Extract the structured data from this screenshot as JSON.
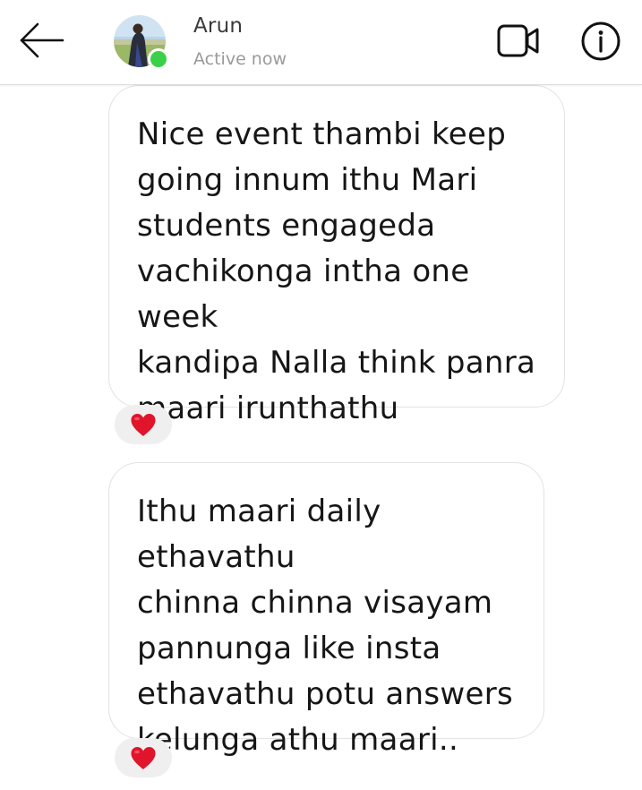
{
  "header": {
    "contact_name": "Arun",
    "status": "Active now",
    "back_icon": "arrow-left-icon",
    "video_icon": "video-camera-icon",
    "info_icon": "info-icon",
    "presence_color": "#3bd04a"
  },
  "messages": [
    {
      "lines": [
        "Nice event thambi keep",
        "going innum ithu Mari",
        "students engageda",
        "vachikonga intha one week",
        "kandipa Nalla think panra",
        "maari irunthathu"
      ],
      "reaction": "❤️"
    },
    {
      "lines": [
        "Ithu maari daily ethavathu",
        "chinna chinna visayam",
        "pannunga like insta",
        "ethavathu potu answers",
        "kelunga athu maari.."
      ],
      "reaction": "❤️"
    }
  ],
  "colors": {
    "reaction_bg": "#efefef",
    "heart": "#e0142b",
    "bubble_border": "#e3e3e3"
  }
}
